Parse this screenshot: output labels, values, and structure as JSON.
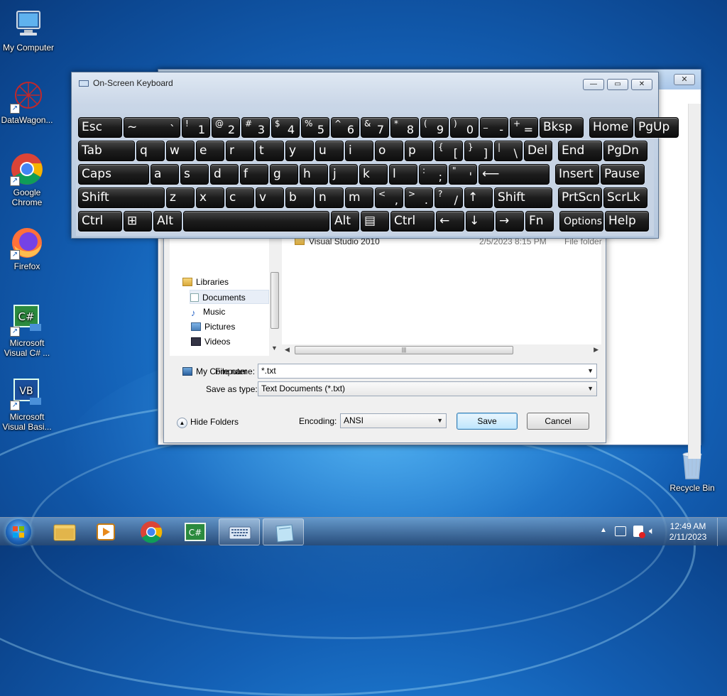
{
  "desktop": {
    "icons": [
      {
        "label": "My Computer"
      },
      {
        "label": "DataWagon..."
      },
      {
        "label": "Google Chrome"
      },
      {
        "label": "Firefox"
      },
      {
        "label": "Microsoft Visual C# ..."
      },
      {
        "label": "Microsoft Visual Basi..."
      },
      {
        "label": "Recycle Bin"
      }
    ]
  },
  "notepad": {
    "close_glyph": "✕"
  },
  "osk": {
    "title": "On-Screen Keyboard",
    "controls": {
      "minimize": "—",
      "restore": "▭",
      "close": "✕"
    },
    "rows": [
      [
        {
          "main": "Esc"
        },
        {
          "main": "~",
          "sub": "`"
        },
        {
          "sup": "!",
          "sub": "1"
        },
        {
          "sup": "@",
          "sub": "2"
        },
        {
          "sup": "#",
          "sub": "3"
        },
        {
          "sup": "$",
          "sub": "4"
        },
        {
          "sup": "%",
          "sub": "5"
        },
        {
          "sup": "^",
          "sub": "6"
        },
        {
          "sup": "&",
          "sub": "7"
        },
        {
          "sup": "*",
          "sub": "8"
        },
        {
          "sup": "(",
          "sub": "9"
        },
        {
          "sup": ")",
          "sub": "0"
        },
        {
          "sup": "_",
          "sub": "-"
        },
        {
          "sup": "+",
          "sub": "="
        },
        {
          "main": "Bksp"
        },
        {
          "main": "Home"
        },
        {
          "main": "PgUp"
        }
      ],
      [
        {
          "main": "Tab"
        },
        {
          "main": "q"
        },
        {
          "main": "w"
        },
        {
          "main": "e"
        },
        {
          "main": "r"
        },
        {
          "main": "t"
        },
        {
          "main": "y"
        },
        {
          "main": "u"
        },
        {
          "main": "i"
        },
        {
          "main": "o"
        },
        {
          "main": "p"
        },
        {
          "sup": "{",
          "sub": "["
        },
        {
          "sup": "}",
          "sub": "]"
        },
        {
          "sup": "|",
          "sub": "\\"
        },
        {
          "main": "Del"
        },
        {
          "main": "End"
        },
        {
          "main": "PgDn"
        }
      ],
      [
        {
          "main": "Caps"
        },
        {
          "main": "a"
        },
        {
          "main": "s"
        },
        {
          "main": "d"
        },
        {
          "main": "f"
        },
        {
          "main": "g"
        },
        {
          "main": "h"
        },
        {
          "main": "j"
        },
        {
          "main": "k"
        },
        {
          "main": "l"
        },
        {
          "sup": ":",
          "sub": ";"
        },
        {
          "sup": "\"",
          "sub": "'"
        },
        {
          "main": "⟵"
        },
        {
          "main": "Insert"
        },
        {
          "main": "Pause"
        }
      ],
      [
        {
          "main": "Shift"
        },
        {
          "main": "z"
        },
        {
          "main": "x"
        },
        {
          "main": "c"
        },
        {
          "main": "v"
        },
        {
          "main": "b"
        },
        {
          "main": "n"
        },
        {
          "main": "m"
        },
        {
          "sup": "<",
          "sub": ","
        },
        {
          "sup": ">",
          "sub": "."
        },
        {
          "sup": "?",
          "sub": "/"
        },
        {
          "main": "↑"
        },
        {
          "main": "Shift"
        },
        {
          "main": "PrtScn"
        },
        {
          "main": "ScrLk"
        }
      ],
      [
        {
          "main": "Ctrl"
        },
        {
          "main": "⊞"
        },
        {
          "main": "Alt"
        },
        {
          "main": ""
        },
        {
          "main": "Alt"
        },
        {
          "main": "▤"
        },
        {
          "main": "Ctrl"
        },
        {
          "main": "←"
        },
        {
          "main": "↓"
        },
        {
          "main": "→"
        },
        {
          "main": "Fn"
        },
        {
          "main": "Options"
        },
        {
          "main": "Help"
        }
      ]
    ]
  },
  "dialog": {
    "nav": {
      "libraries": "Libraries",
      "documents": "Documents",
      "music": "Music",
      "pictures": "Pictures",
      "videos": "Videos",
      "my_computer": "My Computer"
    },
    "file_row": {
      "name": "Visual Studio 2010",
      "date": "2/5/2023 8:15 PM",
      "type": "File folder"
    },
    "file_name_label": "File name:",
    "file_name_value": "*.txt",
    "save_type_label": "Save as type:",
    "save_type_value": "Text Documents (*.txt)",
    "hide_folders": "Hide Folders",
    "encoding_label": "Encoding:",
    "encoding_value": "ANSI",
    "save_button": "Save",
    "cancel_button": "Cancel"
  },
  "taskbar": {
    "clock_time": "12:49 AM",
    "clock_date": "2/11/2023"
  }
}
